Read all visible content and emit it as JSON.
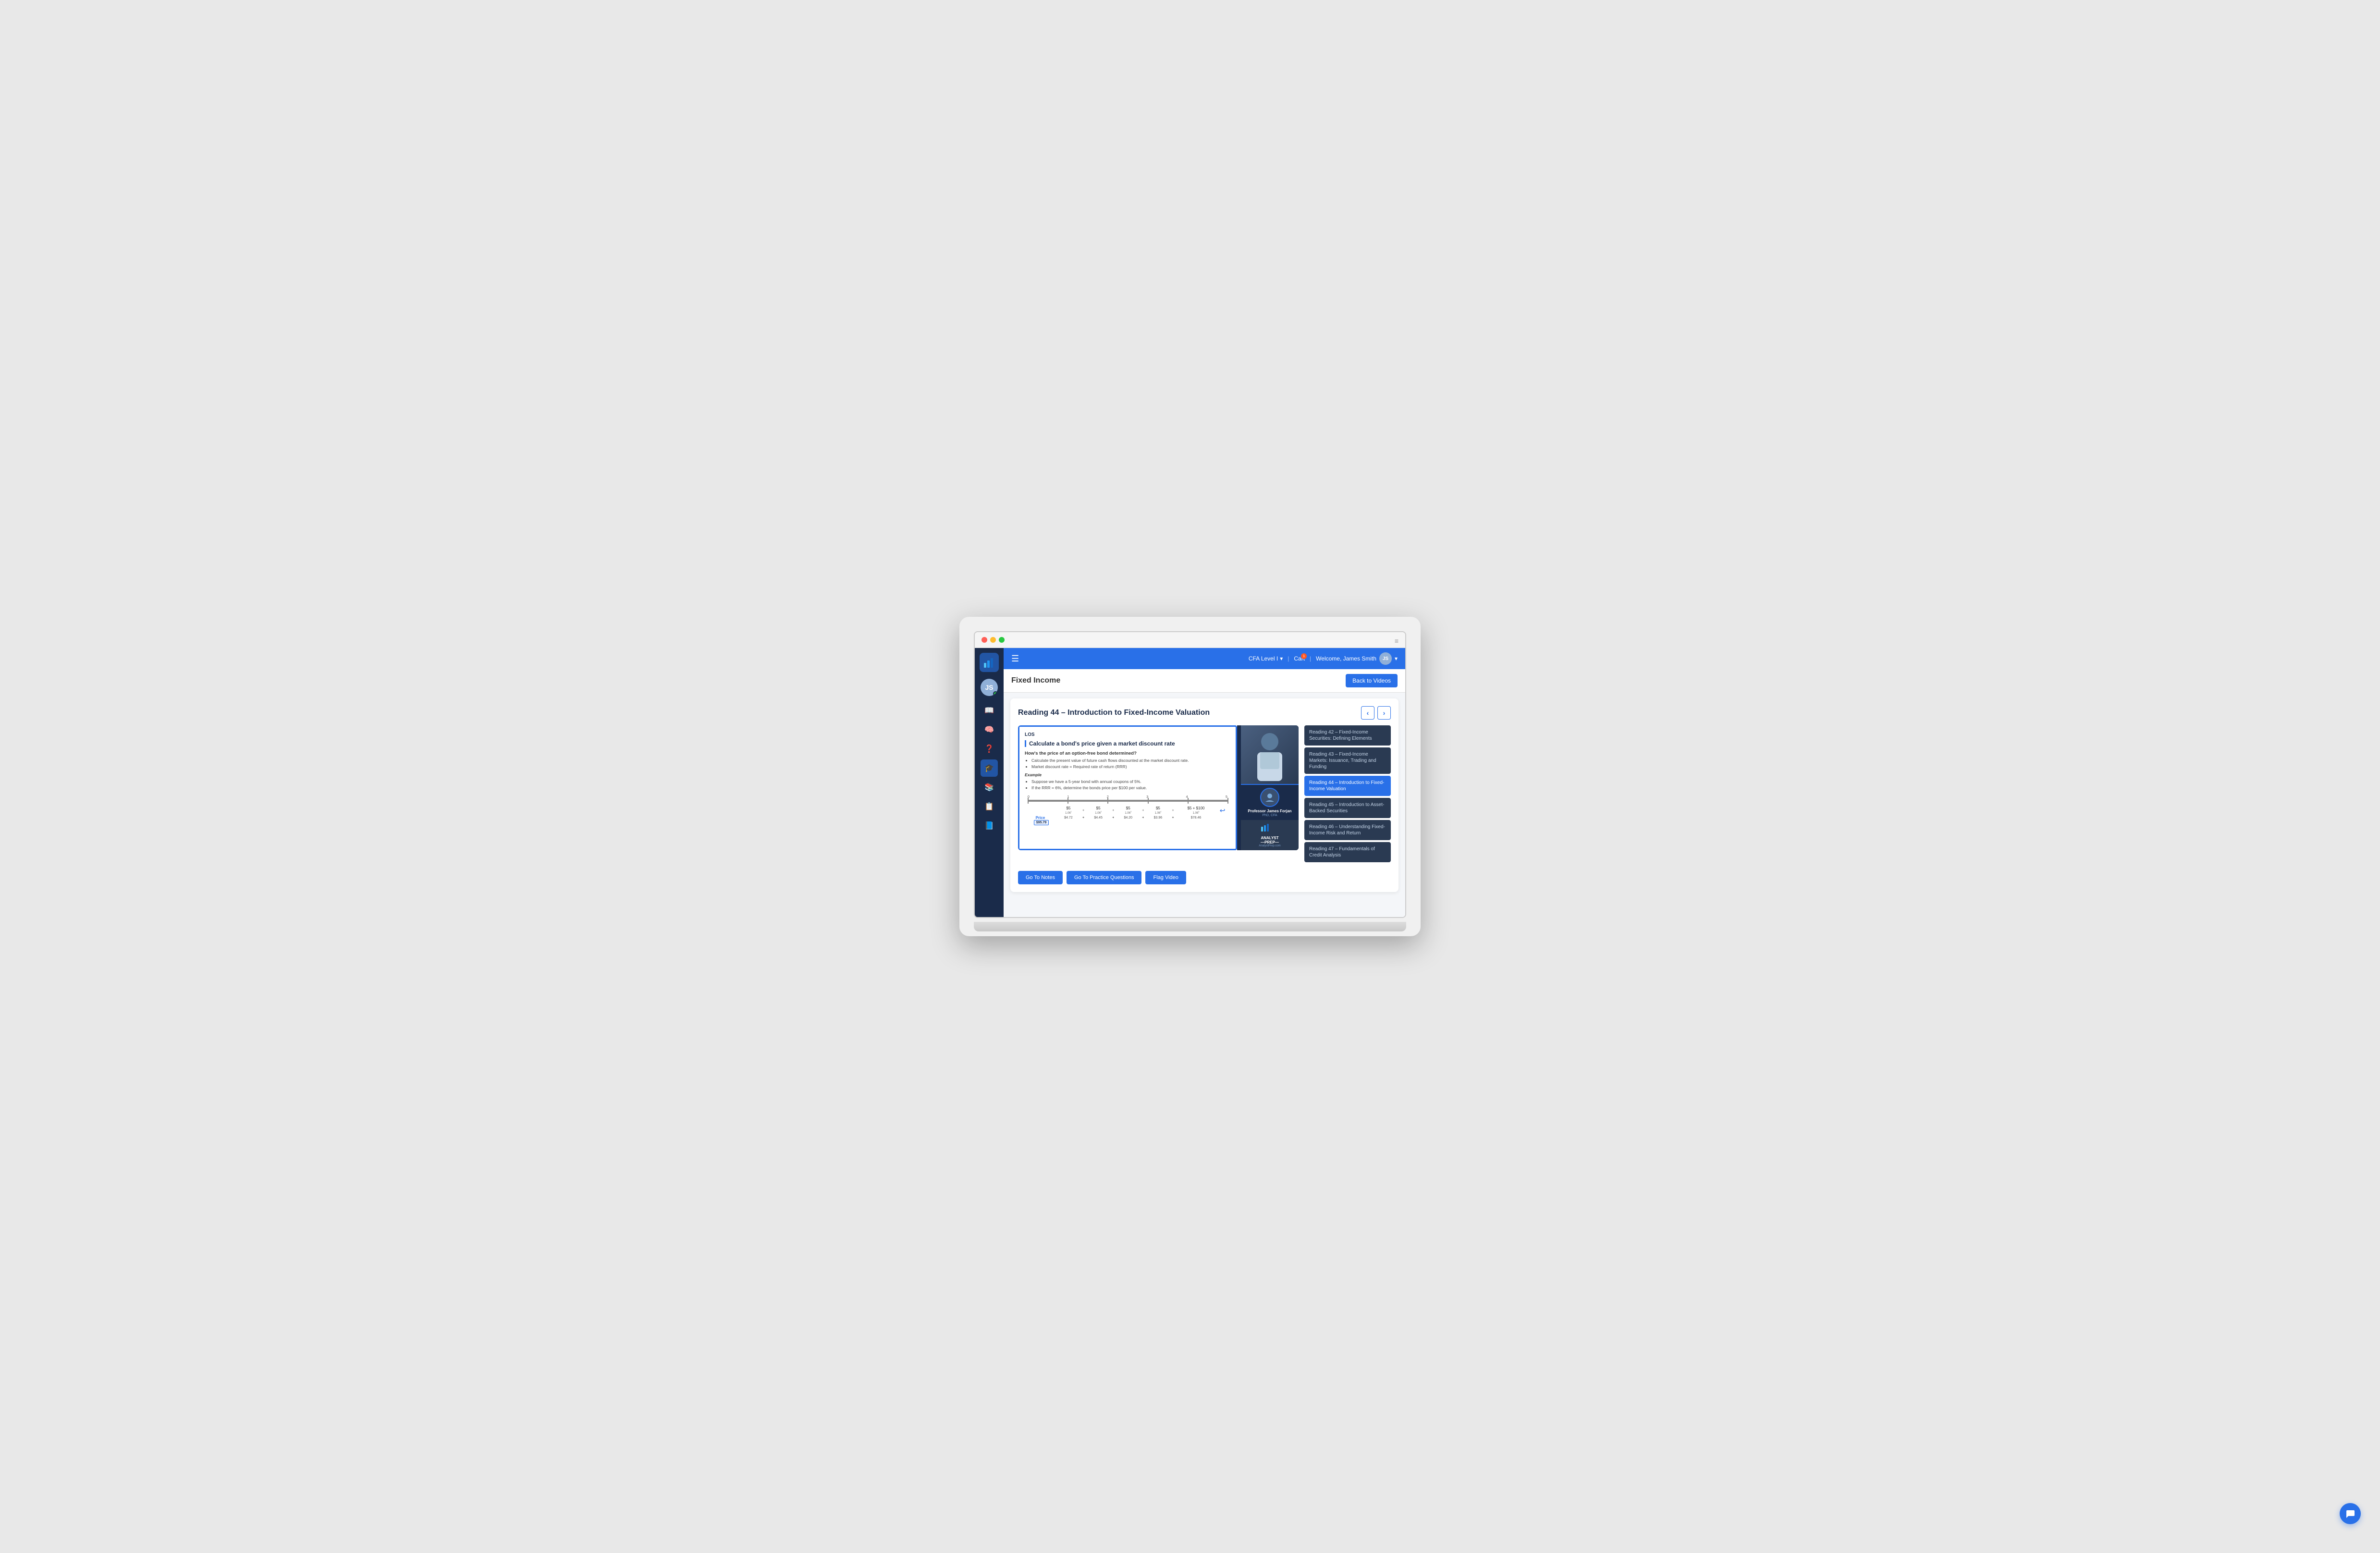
{
  "window": {
    "traffic_lights": [
      "red",
      "yellow",
      "green"
    ],
    "menu_icon": "≡"
  },
  "sidebar": {
    "logo_alt": "AnalystPrep Logo",
    "icons": [
      {
        "name": "book-open-icon",
        "symbol": "📖",
        "active": false
      },
      {
        "name": "brain-icon",
        "symbol": "🧠",
        "active": false
      },
      {
        "name": "help-icon",
        "symbol": "❓",
        "active": false
      },
      {
        "name": "graduation-icon",
        "symbol": "🎓",
        "active": false
      },
      {
        "name": "library-icon",
        "symbol": "📚",
        "active": false
      },
      {
        "name": "clipboard-icon",
        "symbol": "📋",
        "active": false
      },
      {
        "name": "book-icon",
        "symbol": "📘",
        "active": false
      }
    ]
  },
  "topnav": {
    "hamburger": "☰",
    "level_label": "CFA Level I",
    "level_dropdown": "▾",
    "cart_label": "Cart",
    "cart_count": "1",
    "welcome_text": "Welcome, James Smith",
    "user_initials": "JS"
  },
  "page_header": {
    "title": "Fixed Income",
    "back_btn": "Back to Videos"
  },
  "video_card": {
    "title": "Reading 44 – Introduction to Fixed-Income Valuation",
    "prev_arrow": "‹",
    "next_arrow": "›"
  },
  "slide": {
    "los_label": "LOS",
    "heading": "Calculate a bond's price given a market discount rate",
    "question": "How's the price of an option-free bond determined?",
    "bullets": [
      "Calculate the present value of future cash flows discounted at the market discount rate.",
      "Market discount rate = Required rate of return (RRR)"
    ],
    "example_label": "Example",
    "example_bullets": [
      "Suppose we have a 5-year bond with annual coupons of 5%.",
      "If the RRR = 6%, determine the bonds price per $100 per value."
    ],
    "timeline": {
      "points": [
        "0",
        "1",
        "2",
        "3",
        "4",
        "5"
      ],
      "cashflows": [
        "$5",
        "$5",
        "$5",
        "$5",
        "$5 + $100"
      ],
      "denominators": [
        "1.06¹",
        "1.06²",
        "1.06³",
        "1.06⁴",
        "1.06⁵"
      ],
      "values": [
        "$4.72",
        "$4.45",
        "$4.20",
        "$3.96",
        "$78.46"
      ],
      "price": "$95.79",
      "price_label": "Price"
    }
  },
  "professor": {
    "name": "Professor James Forjan",
    "credential": "PhD, CFA",
    "logo": "ANALYST PREP",
    "url": "AnalystPrep.com"
  },
  "readings": [
    {
      "id": "r42",
      "label": "Reading 42 – Fixed-Income Securities: Defining Elements",
      "active": false
    },
    {
      "id": "r43",
      "label": "Reading 43 – Fixed-Income Markets: Issuance, Trading and Funding",
      "active": false
    },
    {
      "id": "r44",
      "label": "Reading 44 – Introduction to Fixed-Income Valuation",
      "active": true
    },
    {
      "id": "r45",
      "label": "Reading 45 – Introduction to Asset-Backed Securities",
      "active": false
    },
    {
      "id": "r46",
      "label": "Reading 46 – Understanding Fixed-Income Risk and Return",
      "active": false
    },
    {
      "id": "r47",
      "label": "Reading 47 – Fundamentals of Credit Analysis",
      "active": false
    }
  ],
  "buttons": {
    "notes": "Go To Notes",
    "practice": "Go To Practice Questions",
    "flag": "Flag Video"
  },
  "chat": {
    "icon": "💬"
  }
}
